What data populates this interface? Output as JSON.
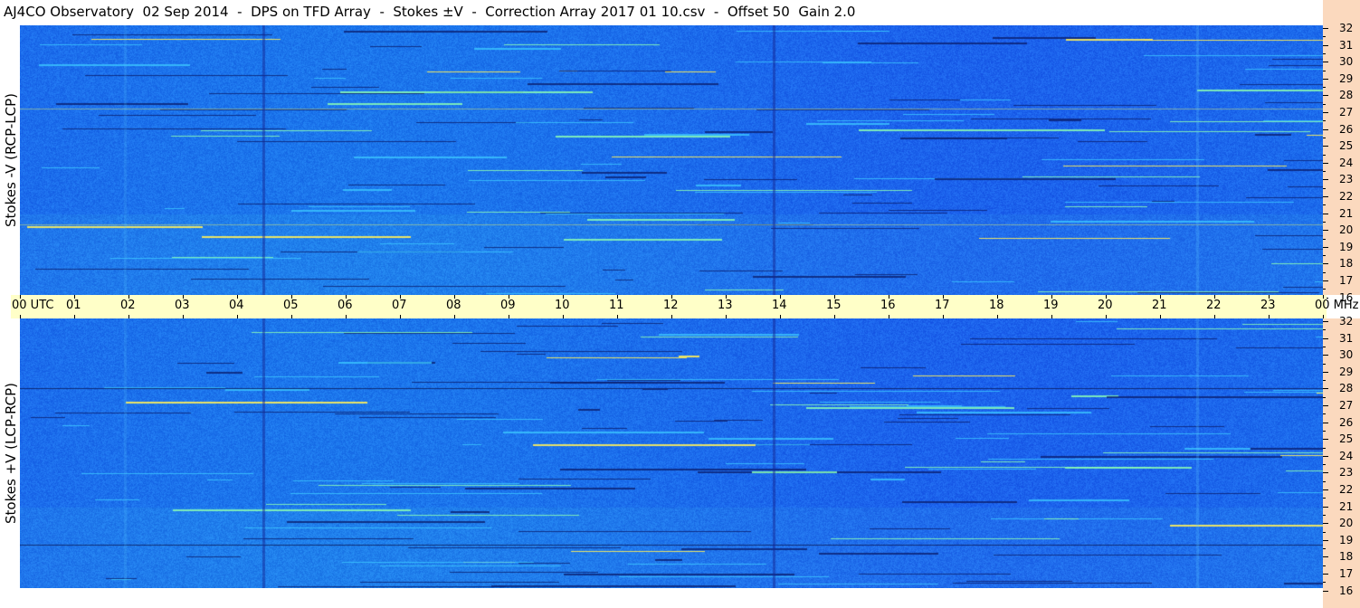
{
  "header": {
    "title": "AJ4CO Observatory  02 Sep 2014  -  DPS on TFD Array  -  Stokes ±V  -  Correction Array 2017 01 10.csv  -  Offset 50  Gain 2.0"
  },
  "panels": [
    {
      "id": "top",
      "ylabel": "Stokes -V (RCP-LCP)"
    },
    {
      "id": "bottom",
      "ylabel": "Stokes +V (LCP-RCP)"
    }
  ],
  "time_axis": {
    "labels": [
      "00 UTC",
      "01",
      "02",
      "03",
      "04",
      "05",
      "06",
      "07",
      "08",
      "09",
      "10",
      "11",
      "12",
      "13",
      "14",
      "15",
      "16",
      "17",
      "18",
      "19",
      "20",
      "21",
      "22",
      "23",
      "00 MHz"
    ]
  },
  "freq_axis": {
    "labels": [
      "32",
      "31",
      "30",
      "29",
      "28",
      "27",
      "26",
      "25",
      "24",
      "23",
      "22",
      "21",
      "20",
      "19",
      "18",
      "17",
      "16"
    ]
  },
  "colors": {
    "background": "#1f6ff0",
    "scale_bg": "#fbd9be",
    "timebar_bg": "#ffffc8"
  }
}
